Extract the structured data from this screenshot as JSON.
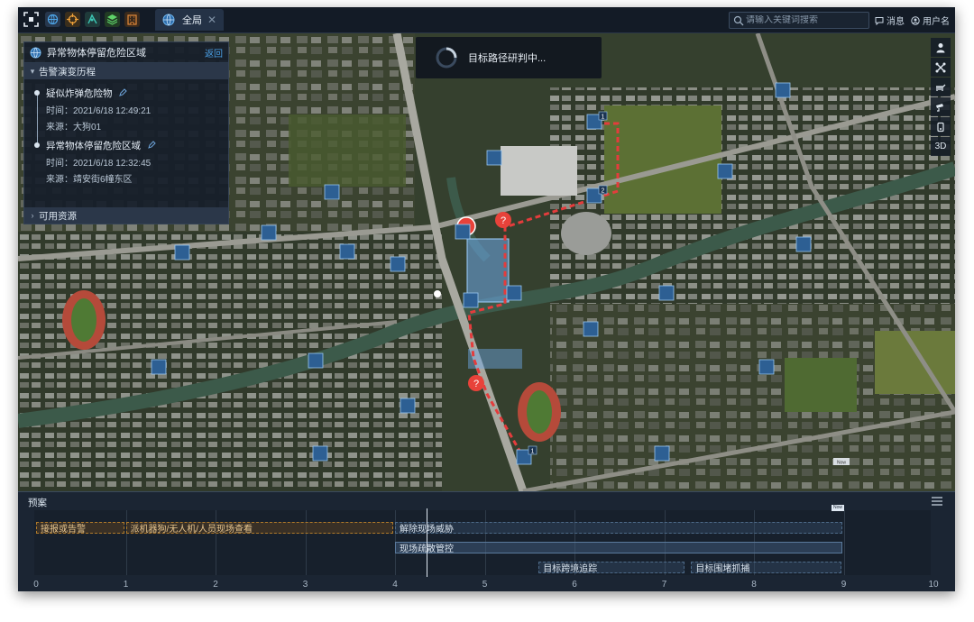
{
  "topbar": {
    "tab_label": "全局",
    "search_placeholder": "请输入关键词搜索",
    "messages_label": "消息",
    "user_label": "用户名"
  },
  "panel": {
    "title": "异常物体停留危险区域",
    "back_label": "返回",
    "section_history": "告警演变历程",
    "section_resources": "可用资源",
    "events": [
      {
        "title": "疑似炸弹危险物",
        "time": "时间：2021/6/18  12:49:21",
        "source": "来源：大狗01"
      },
      {
        "title": "异常物体停留危险区域",
        "time": "时间：2021/6/18  12:32:45",
        "source": "来源：靖安街6幢东区"
      }
    ]
  },
  "toast": {
    "message": "目标路径研判中..."
  },
  "rail": {
    "mode_3d": "3D"
  },
  "map": {
    "tags": [
      "1",
      "2",
      "1"
    ],
    "label_now_small": "Now"
  },
  "plan": {
    "title": "预案",
    "now_label": "Now",
    "tasks": [
      {
        "label": "接报或告警",
        "start": 0,
        "end": 1,
        "row": 0,
        "style": "orange"
      },
      {
        "label": "派机器狗/无人机/人员现场查看",
        "start": 1,
        "end": 4,
        "row": 0,
        "style": "orange"
      },
      {
        "label": "解除现场威胁",
        "start": 4,
        "end": 9,
        "row": 0,
        "style": "blue"
      },
      {
        "label": "现场疏散管控",
        "start": 4,
        "end": 9,
        "row": 1,
        "style": "solid"
      },
      {
        "label": "目标跨境追踪",
        "start": 5.6,
        "end": 7.25,
        "row": 2,
        "style": "blue"
      },
      {
        "label": "目标围堵抓捕",
        "start": 7.3,
        "end": 9,
        "row": 2,
        "style": "blue"
      }
    ],
    "axis": [
      "0",
      "1",
      "2",
      "3",
      "4",
      "5",
      "6",
      "7",
      "8",
      "9",
      "10"
    ]
  }
}
